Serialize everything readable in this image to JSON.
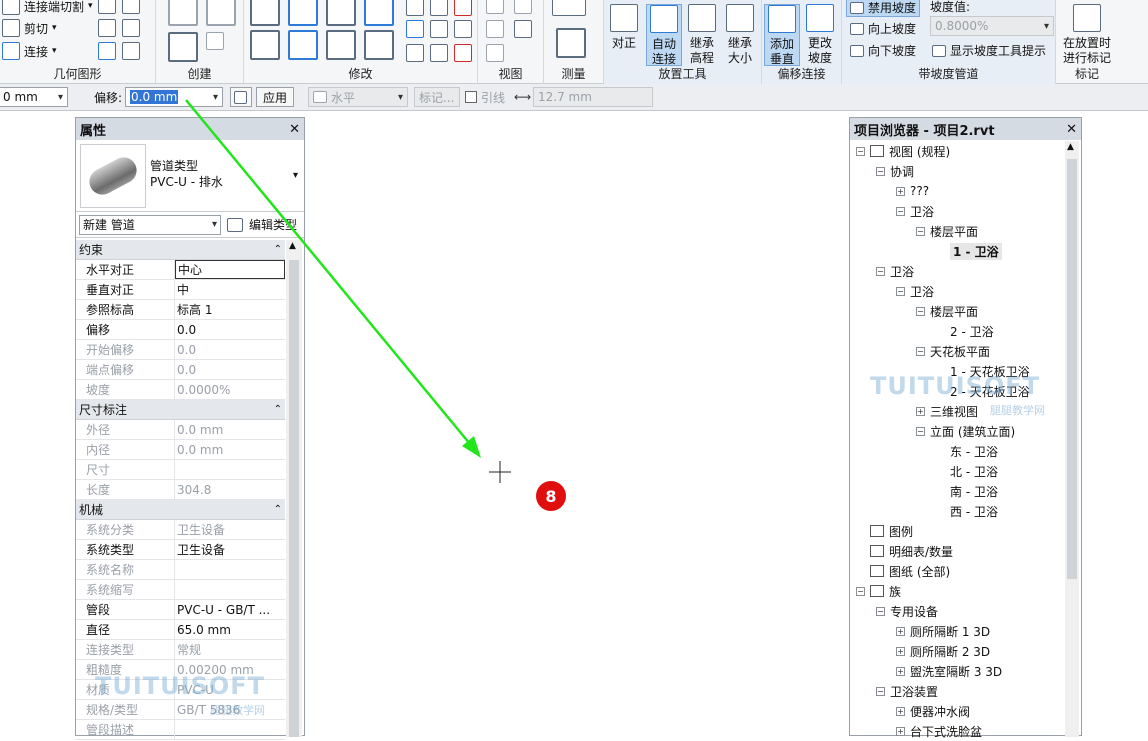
{
  "ribbon": {
    "geometry": {
      "title": "几何图形",
      "items": [
        {
          "label": "连接端切割",
          "icon": "cope-icon"
        },
        {
          "label": "剪切",
          "icon": "cut-icon"
        },
        {
          "label": "连接",
          "icon": "join-icon"
        }
      ]
    },
    "create": {
      "title": "创建"
    },
    "modify": {
      "title": "修改"
    },
    "view": {
      "title": "视图"
    },
    "measure": {
      "title": "测量"
    },
    "placement": {
      "title": "放置工具",
      "buttons": [
        "对正",
        "自动\n连接",
        "继承\n高程",
        "继承\n大小"
      ]
    },
    "offset": {
      "title": "偏移连接",
      "buttons": [
        "添加\n垂直",
        "更改\n坡度"
      ]
    },
    "slope": {
      "title": "带坡度管道",
      "items": [
        "禁用坡度",
        "向上坡度",
        "向下坡度"
      ],
      "value_label": "坡度值:",
      "value": "0.8000%",
      "show_tool": "显示坡度工具提示"
    },
    "tag": {
      "title": "标记",
      "button": "在放置时\n进行标记"
    }
  },
  "options_bar": {
    "diameter_tail": "0 mm",
    "offset_label": "偏移:",
    "offset_value": "0.0 mm",
    "apply": "应用",
    "horizontal": "水平",
    "tag": "标记...",
    "leader": "引线",
    "leader_length": "12.7 mm"
  },
  "properties": {
    "title": "属性",
    "type_name": "管道类型",
    "type_value": "PVC-U - 排水",
    "instance_selector": "新建 管道",
    "edit_type": "编辑类型",
    "sections": [
      {
        "name": "约束",
        "rows": [
          {
            "k": "水平对正",
            "v": "中心",
            "dim": false
          },
          {
            "k": "垂直对正",
            "v": "中",
            "dim": false
          },
          {
            "k": "参照标高",
            "v": "标高 1",
            "dim": false
          },
          {
            "k": "偏移",
            "v": "0.0",
            "dim": false
          },
          {
            "k": "开始偏移",
            "v": "0.0",
            "dim": true
          },
          {
            "k": "端点偏移",
            "v": "0.0",
            "dim": true
          },
          {
            "k": "坡度",
            "v": "0.0000%",
            "dim": true
          }
        ]
      },
      {
        "name": "尺寸标注",
        "rows": [
          {
            "k": "外径",
            "v": "0.0 mm",
            "dim": true
          },
          {
            "k": "内径",
            "v": "0.0 mm",
            "dim": true
          },
          {
            "k": "尺寸",
            "v": "",
            "dim": true
          },
          {
            "k": "长度",
            "v": "304.8",
            "dim": true
          }
        ]
      },
      {
        "name": "机械",
        "rows": [
          {
            "k": "系统分类",
            "v": "卫生设备",
            "dim": true
          },
          {
            "k": "系统类型",
            "v": "卫生设备",
            "dim": false
          },
          {
            "k": "系统名称",
            "v": "",
            "dim": true
          },
          {
            "k": "系统缩写",
            "v": "",
            "dim": true
          },
          {
            "k": "管段",
            "v": "PVC-U - GB/T ...",
            "dim": false
          },
          {
            "k": "直径",
            "v": "65.0 mm",
            "dim": false
          },
          {
            "k": "连接类型",
            "v": "常规",
            "dim": true
          },
          {
            "k": "粗糙度",
            "v": "0.00200 mm",
            "dim": true
          },
          {
            "k": "材质",
            "v": "PVC-U",
            "dim": true
          },
          {
            "k": "规格/类型",
            "v": "GB/T 5836",
            "dim": true
          },
          {
            "k": "管段描述",
            "v": "",
            "dim": true
          }
        ]
      }
    ]
  },
  "canvas": {
    "step_badge": "8",
    "arrow_color": "#22e61a"
  },
  "browser": {
    "title": "项目浏览器 - 项目2.rvt",
    "nodes": [
      {
        "level": 0,
        "tog": "−",
        "icon": "view-icon",
        "text": "视图 (规程)"
      },
      {
        "level": 1,
        "tog": "−",
        "text": "协调"
      },
      {
        "level": 2,
        "tog": "+",
        "text": "???"
      },
      {
        "level": 2,
        "tog": "−",
        "text": "卫浴"
      },
      {
        "level": 3,
        "tog": "−",
        "text": "楼层平面"
      },
      {
        "level": 4,
        "tog": "",
        "text": "1 - 卫浴",
        "bold": true
      },
      {
        "level": 1,
        "tog": "−",
        "text": "卫浴"
      },
      {
        "level": 2,
        "tog": "−",
        "text": "卫浴"
      },
      {
        "level": 3,
        "tog": "−",
        "text": "楼层平面"
      },
      {
        "level": 4,
        "tog": "",
        "text": "2 - 卫浴"
      },
      {
        "level": 3,
        "tog": "−",
        "text": "天花板平面"
      },
      {
        "level": 4,
        "tog": "",
        "text": "1 - 天花板卫浴"
      },
      {
        "level": 4,
        "tog": "",
        "text": "2 - 天花板卫浴"
      },
      {
        "level": 3,
        "tog": "+",
        "text": "三维视图"
      },
      {
        "level": 3,
        "tog": "−",
        "text": "立面 (建筑立面)"
      },
      {
        "level": 4,
        "tog": "",
        "text": "东 - 卫浴"
      },
      {
        "level": 4,
        "tog": "",
        "text": "北 - 卫浴"
      },
      {
        "level": 4,
        "tog": "",
        "text": "南 - 卫浴"
      },
      {
        "level": 4,
        "tog": "",
        "text": "西 - 卫浴"
      },
      {
        "level": 0,
        "tog": "",
        "icon": "legend-icon",
        "text": "图例"
      },
      {
        "level": 0,
        "tog": "",
        "icon": "schedule-icon",
        "text": "明细表/数量"
      },
      {
        "level": 0,
        "tog": "",
        "icon": "sheet-icon",
        "text": "图纸 (全部)"
      },
      {
        "level": 0,
        "tog": "−",
        "icon": "family-icon",
        "text": "族"
      },
      {
        "level": 1,
        "tog": "−",
        "text": "专用设备"
      },
      {
        "level": 2,
        "tog": "+",
        "text": "厕所隔断 1 3D"
      },
      {
        "level": 2,
        "tog": "+",
        "text": "厕所隔断 2 3D"
      },
      {
        "level": 2,
        "tog": "+",
        "text": "盥洗室隔断 3 3D"
      },
      {
        "level": 1,
        "tog": "−",
        "text": "卫浴装置"
      },
      {
        "level": 2,
        "tog": "+",
        "text": "便器冲水阀"
      },
      {
        "level": 2,
        "tog": "+",
        "text": "台下式洗脸盆"
      }
    ]
  },
  "watermark": {
    "brand": "TUITUISOFT",
    "sub": "腿腿教学网"
  }
}
